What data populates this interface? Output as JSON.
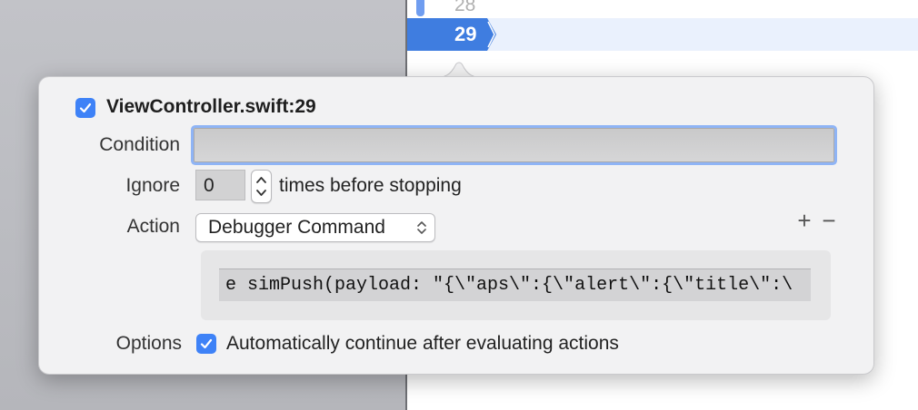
{
  "editor": {
    "prev_line_number": "28",
    "current_line_number": "29"
  },
  "breakpoint": {
    "title": "ViewController.swift:29",
    "enabled": true,
    "condition": {
      "label": "Condition",
      "value": ""
    },
    "ignore": {
      "label": "Ignore",
      "value": "0",
      "suffix": "times before stopping"
    },
    "action": {
      "label": "Action",
      "selected": "Debugger Command",
      "add_symbol": "+",
      "remove_symbol": "−",
      "command": "e simPush(payload: \"{\\\"aps\\\":{\\\"alert\\\":{\\\"title\\\":\\"
    },
    "options": {
      "label": "Options",
      "auto_continue_checked": true,
      "auto_continue_label": "Automatically continue after evaluating actions"
    }
  },
  "colors": {
    "accent": "#3e82f7",
    "breakpoint_blue": "#3f7de0",
    "current_line_bg": "#eaf1fd"
  }
}
